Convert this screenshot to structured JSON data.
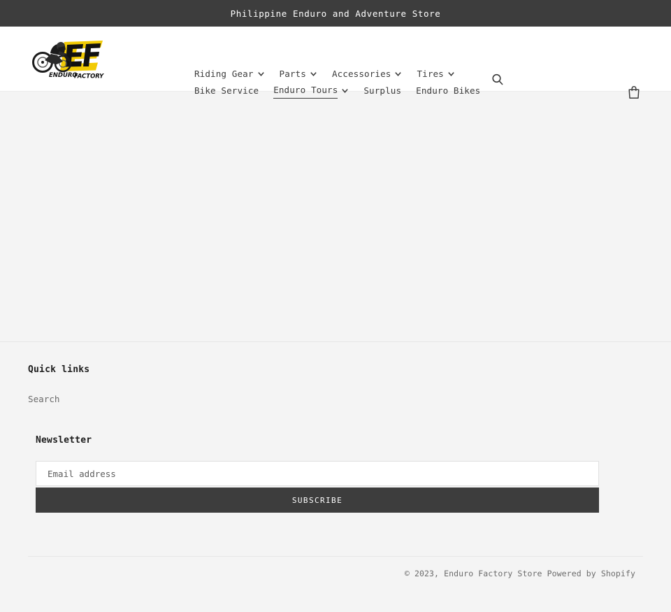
{
  "announcement": {
    "text": "Philippine Enduro and Adventure Store"
  },
  "header": {
    "logo": {
      "alt": "Enduro Factory",
      "monogram": "EF",
      "wordmark_left": "ENDURO",
      "wordmark_right": "FACTORY",
      "yellow": "#F2CB05",
      "black": "#111111"
    },
    "search_icon": "search-icon",
    "cart_icon": "shopping-bag-icon",
    "nav_row_one": [
      {
        "label": "Riding Gear",
        "has_dropdown": true,
        "active": false
      },
      {
        "label": "Parts",
        "has_dropdown": true,
        "active": false
      },
      {
        "label": "Accessories",
        "has_dropdown": true,
        "active": false
      },
      {
        "label": "Tires",
        "has_dropdown": true,
        "active": false
      }
    ],
    "nav_row_two": [
      {
        "label": "Bike Service",
        "has_dropdown": false,
        "active": false
      },
      {
        "label": "Enduro Tours",
        "has_dropdown": true,
        "active": true
      },
      {
        "label": "Surplus",
        "has_dropdown": false,
        "active": false
      },
      {
        "label": "Enduro Bikes",
        "has_dropdown": false,
        "active": false
      }
    ]
  },
  "footer": {
    "quick_links_heading": "Quick links",
    "quick_links": [
      {
        "label": "Search"
      }
    ],
    "newsletter_heading": "Newsletter",
    "email_placeholder": "Email address",
    "email_value": "",
    "subscribe_label": "SUBSCRIBE",
    "copyright": "© 2023, Enduro Factory Store Powered by Shopify"
  },
  "colors": {
    "dark": "#3d3d3d",
    "page_bg": "#f4f4f4",
    "header_bg": "#ffffff",
    "muted_text": "#6b6b6b"
  }
}
